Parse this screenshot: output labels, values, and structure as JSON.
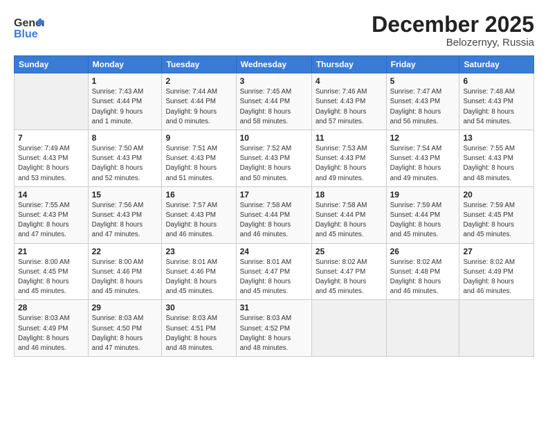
{
  "header": {
    "logo_line1": "General",
    "logo_line2": "Blue",
    "month": "December 2025",
    "location": "Belozernyy, Russia"
  },
  "days_of_week": [
    "Sunday",
    "Monday",
    "Tuesday",
    "Wednesday",
    "Thursday",
    "Friday",
    "Saturday"
  ],
  "weeks": [
    [
      {
        "day": "",
        "info": ""
      },
      {
        "day": "1",
        "info": "Sunrise: 7:43 AM\nSunset: 4:44 PM\nDaylight: 9 hours\nand 1 minute."
      },
      {
        "day": "2",
        "info": "Sunrise: 7:44 AM\nSunset: 4:44 PM\nDaylight: 9 hours\nand 0 minutes."
      },
      {
        "day": "3",
        "info": "Sunrise: 7:45 AM\nSunset: 4:44 PM\nDaylight: 8 hours\nand 58 minutes."
      },
      {
        "day": "4",
        "info": "Sunrise: 7:46 AM\nSunset: 4:43 PM\nDaylight: 8 hours\nand 57 minutes."
      },
      {
        "day": "5",
        "info": "Sunrise: 7:47 AM\nSunset: 4:43 PM\nDaylight: 8 hours\nand 56 minutes."
      },
      {
        "day": "6",
        "info": "Sunrise: 7:48 AM\nSunset: 4:43 PM\nDaylight: 8 hours\nand 54 minutes."
      }
    ],
    [
      {
        "day": "7",
        "info": "Sunrise: 7:49 AM\nSunset: 4:43 PM\nDaylight: 8 hours\nand 53 minutes."
      },
      {
        "day": "8",
        "info": "Sunrise: 7:50 AM\nSunset: 4:43 PM\nDaylight: 8 hours\nand 52 minutes."
      },
      {
        "day": "9",
        "info": "Sunrise: 7:51 AM\nSunset: 4:43 PM\nDaylight: 8 hours\nand 51 minutes."
      },
      {
        "day": "10",
        "info": "Sunrise: 7:52 AM\nSunset: 4:43 PM\nDaylight: 8 hours\nand 50 minutes."
      },
      {
        "day": "11",
        "info": "Sunrise: 7:53 AM\nSunset: 4:43 PM\nDaylight: 8 hours\nand 49 minutes."
      },
      {
        "day": "12",
        "info": "Sunrise: 7:54 AM\nSunset: 4:43 PM\nDaylight: 8 hours\nand 49 minutes."
      },
      {
        "day": "13",
        "info": "Sunrise: 7:55 AM\nSunset: 4:43 PM\nDaylight: 8 hours\nand 48 minutes."
      }
    ],
    [
      {
        "day": "14",
        "info": "Sunrise: 7:55 AM\nSunset: 4:43 PM\nDaylight: 8 hours\nand 47 minutes."
      },
      {
        "day": "15",
        "info": "Sunrise: 7:56 AM\nSunset: 4:43 PM\nDaylight: 8 hours\nand 47 minutes."
      },
      {
        "day": "16",
        "info": "Sunrise: 7:57 AM\nSunset: 4:43 PM\nDaylight: 8 hours\nand 46 minutes."
      },
      {
        "day": "17",
        "info": "Sunrise: 7:58 AM\nSunset: 4:44 PM\nDaylight: 8 hours\nand 46 minutes."
      },
      {
        "day": "18",
        "info": "Sunrise: 7:58 AM\nSunset: 4:44 PM\nDaylight: 8 hours\nand 45 minutes."
      },
      {
        "day": "19",
        "info": "Sunrise: 7:59 AM\nSunset: 4:44 PM\nDaylight: 8 hours\nand 45 minutes."
      },
      {
        "day": "20",
        "info": "Sunrise: 7:59 AM\nSunset: 4:45 PM\nDaylight: 8 hours\nand 45 minutes."
      }
    ],
    [
      {
        "day": "21",
        "info": "Sunrise: 8:00 AM\nSunset: 4:45 PM\nDaylight: 8 hours\nand 45 minutes."
      },
      {
        "day": "22",
        "info": "Sunrise: 8:00 AM\nSunset: 4:46 PM\nDaylight: 8 hours\nand 45 minutes."
      },
      {
        "day": "23",
        "info": "Sunrise: 8:01 AM\nSunset: 4:46 PM\nDaylight: 8 hours\nand 45 minutes."
      },
      {
        "day": "24",
        "info": "Sunrise: 8:01 AM\nSunset: 4:47 PM\nDaylight: 8 hours\nand 45 minutes."
      },
      {
        "day": "25",
        "info": "Sunrise: 8:02 AM\nSunset: 4:47 PM\nDaylight: 8 hours\nand 45 minutes."
      },
      {
        "day": "26",
        "info": "Sunrise: 8:02 AM\nSunset: 4:48 PM\nDaylight: 8 hours\nand 46 minutes."
      },
      {
        "day": "27",
        "info": "Sunrise: 8:02 AM\nSunset: 4:49 PM\nDaylight: 8 hours\nand 46 minutes."
      }
    ],
    [
      {
        "day": "28",
        "info": "Sunrise: 8:03 AM\nSunset: 4:49 PM\nDaylight: 8 hours\nand 46 minutes."
      },
      {
        "day": "29",
        "info": "Sunrise: 8:03 AM\nSunset: 4:50 PM\nDaylight: 8 hours\nand 47 minutes."
      },
      {
        "day": "30",
        "info": "Sunrise: 8:03 AM\nSunset: 4:51 PM\nDaylight: 8 hours\nand 48 minutes."
      },
      {
        "day": "31",
        "info": "Sunrise: 8:03 AM\nSunset: 4:52 PM\nDaylight: 8 hours\nand 48 minutes."
      },
      {
        "day": "",
        "info": ""
      },
      {
        "day": "",
        "info": ""
      },
      {
        "day": "",
        "info": ""
      }
    ]
  ]
}
